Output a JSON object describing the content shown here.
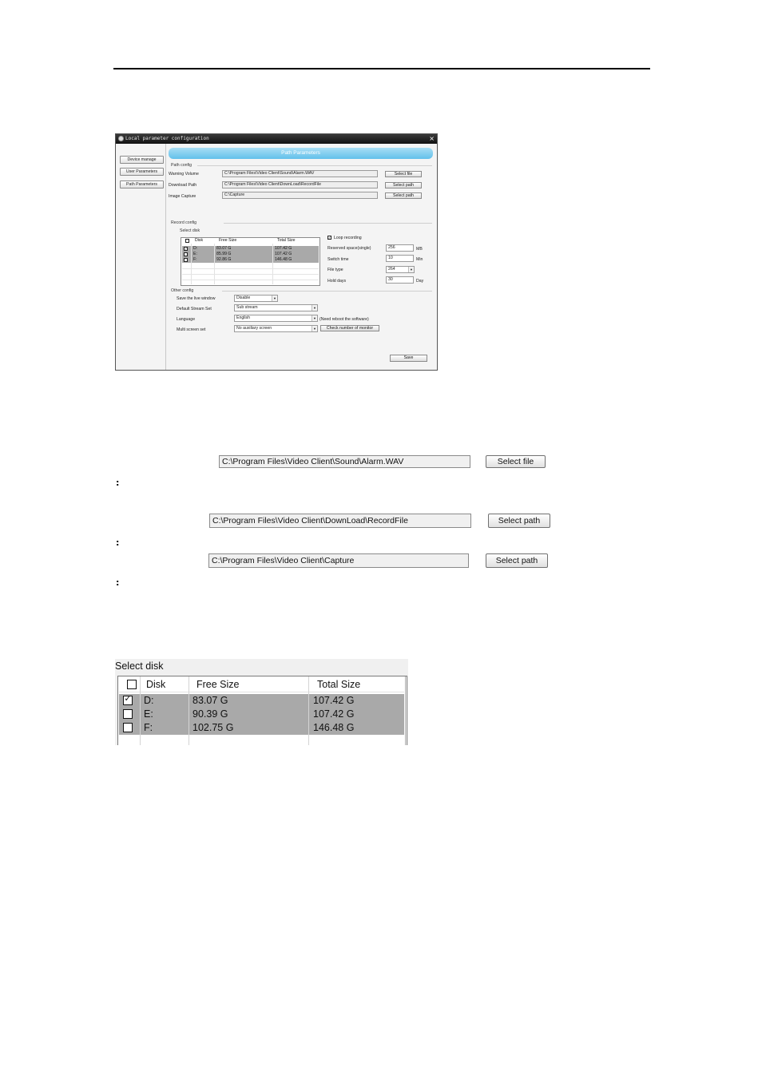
{
  "dialog": {
    "title": "Local parameter configuration",
    "close_glyph": "×",
    "sidebar": [
      {
        "label": "Device manage"
      },
      {
        "label": "User Parameters"
      },
      {
        "label": "Path Parameters"
      }
    ],
    "banner": "Path Parameters",
    "path_config": {
      "group_label": "Path config",
      "rows": [
        {
          "label": "Warning Volume",
          "value": "C:\\Program Files\\Video Client\\Sound\\Alarm.WAV",
          "button": "Select file"
        },
        {
          "label": "Download Path",
          "value": "C:\\Program Files\\Video Client\\DownLoad\\RecordFile",
          "button": "Select path"
        },
        {
          "label": "Image Capture",
          "value": "C:\\Capture",
          "button": "Select path"
        }
      ]
    },
    "record_config": {
      "group_label": "Record config",
      "select_disk_label": "Select disk",
      "columns": [
        "Disk",
        "Free Size",
        "Total Size"
      ],
      "disks": [
        {
          "disk": "D:",
          "free": "83.07 G",
          "total": "107.42 G",
          "checked": true
        },
        {
          "disk": "E:",
          "free": "85.99 G",
          "total": "107.42 G",
          "checked": false
        },
        {
          "disk": "F:",
          "free": "92.86 G",
          "total": "146.48 G",
          "checked": false
        }
      ],
      "loop_recording_label": "Loop recording",
      "loop_recording_checked": true,
      "reserved_space": {
        "label": "Reserved space(single)",
        "value": "256",
        "unit": "MB"
      },
      "switch_time": {
        "label": "Switch time",
        "value": "10",
        "unit": "Min"
      },
      "file_type": {
        "label": "File type",
        "value": "264"
      },
      "hold_days": {
        "label": "Hold days",
        "value": "30",
        "unit": "Day"
      }
    },
    "other_config": {
      "group_label": "Other config",
      "save_live_window": {
        "label": "Save the live window",
        "value": "Disable"
      },
      "default_stream": {
        "label": "Default Stream Set",
        "value": "Sub stream"
      },
      "language": {
        "label": "Language",
        "value": "English",
        "note": "(Need reboot the software)"
      },
      "multi_screen": {
        "label": "Multi screen set",
        "value": "No auxiliary screen",
        "button": "Check number of monitor"
      }
    },
    "save_button": "Save"
  },
  "path_rows": [
    {
      "value": "C:\\Program Files\\Video Client\\Sound\\Alarm.WAV",
      "button": "Select file"
    },
    {
      "value": "C:\\Program Files\\Video Client\\DownLoad\\RecordFile",
      "button": "Select path"
    },
    {
      "value": "C:\\Program Files\\Video Client\\Capture",
      "button": "Select path"
    }
  ],
  "colon": ":",
  "select_disk": {
    "title": "Select disk",
    "columns": [
      "Disk",
      "Free Size",
      "Total Size"
    ],
    "disks": [
      {
        "disk": "D:",
        "free": "83.07 G",
        "total": "107.42 G",
        "checked": true
      },
      {
        "disk": "E:",
        "free": "90.39 G",
        "total": "107.42 G",
        "checked": false
      },
      {
        "disk": "F:",
        "free": "102.75 G",
        "total": "146.48 G",
        "checked": false
      }
    ]
  }
}
